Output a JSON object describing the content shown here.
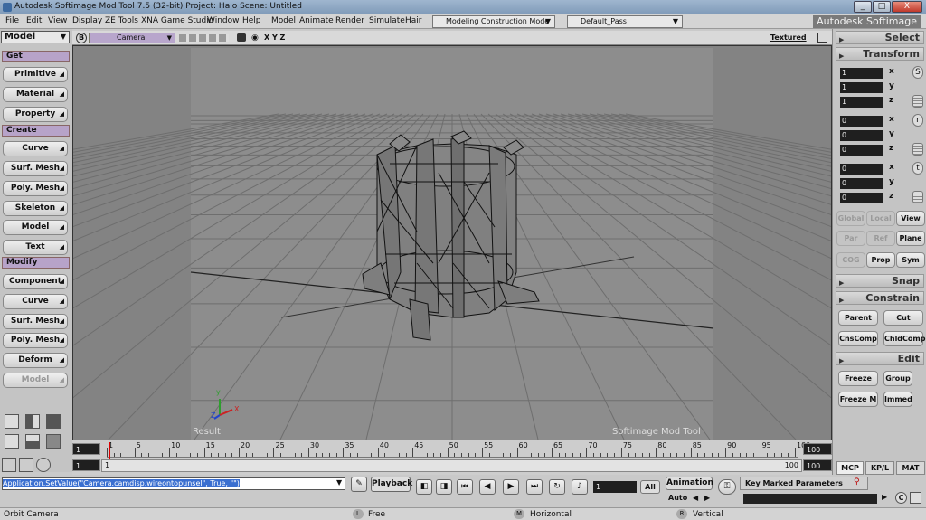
{
  "window": {
    "title": "Autodesk Softimage Mod Tool 7.5 (32-bit)     Project: Halo     Scene: Untitled",
    "min_label": "_",
    "max_label": "□",
    "close_label": "X"
  },
  "menu": {
    "items": [
      "File",
      "Edit",
      "View",
      "Display",
      "ZE Tools",
      "XNA Game Studio",
      "Window",
      "Help",
      "Model",
      "Animate",
      "Render",
      "Simulate",
      "Hair"
    ],
    "mode_dropdown": "Modeling Construction Mode",
    "pass_dropdown": "Default_Pass",
    "brand": "Autodesk Softimage"
  },
  "left_panel": {
    "mode_select": "Model",
    "get_header": "Get",
    "get_buttons": [
      "Primitive",
      "Material",
      "Property"
    ],
    "create_header": "Create",
    "create_buttons": [
      "Curve",
      "Surf. Mesh",
      "Poly. Mesh",
      "Skeleton",
      "Model",
      "Text"
    ],
    "modify_header": "Modify",
    "modify_buttons": [
      "Component",
      "Curve",
      "Surf. Mesh",
      "Poly. Mesh",
      "Deform",
      "Model"
    ]
  },
  "viewport": {
    "b_label": "B",
    "camera_select": "Camera",
    "xyz": "X Y Z",
    "display_mode": "Textured",
    "result_label": "Result",
    "watermark": "Softimage Mod Tool",
    "axes": {
      "y": "y",
      "x": "X",
      "z": "Z"
    }
  },
  "timeline": {
    "start_frame": "1",
    "end_frame": "100",
    "current_start": "1",
    "range_end_a": "100",
    "range_end_b": "100",
    "slider_start": "1",
    "ticks": [
      "1",
      "5",
      "10",
      "15",
      "20",
      "25",
      "30",
      "35",
      "40",
      "45",
      "50",
      "55",
      "60",
      "65",
      "70",
      "75",
      "80",
      "85",
      "90",
      "95",
      "100"
    ],
    "current_frame_fraction": 0.0
  },
  "command_bar": {
    "command_text": "Application.SetValue(\"Camera.camdisp.wireontopunsel\", True, \"\")",
    "playback_label": "Playback",
    "frame_value": "1",
    "all_label": "All",
    "animation_label": "Animation",
    "auto_label": "Auto",
    "key_marked_label": "Key Marked Parameters"
  },
  "status_bar": {
    "camera_label": "Orbit Camera",
    "l_label": "L",
    "l_text": "Free",
    "m_label": "M",
    "m_text": "Horizontal",
    "r_label": "R",
    "r_text": "Vertical"
  },
  "right_panel": {
    "select_header": "Select",
    "transform_header": "Transform",
    "scale_values": [
      "1",
      "1",
      "1"
    ],
    "rotate_values": [
      "0",
      "0",
      "0"
    ],
    "translate_values": [
      "0",
      "0",
      "0"
    ],
    "axis_labels": [
      "x",
      "y",
      "z"
    ],
    "s_label": "S",
    "r_label": "r",
    "t_label": "t",
    "space_buttons": [
      "Global",
      "Local",
      "View"
    ],
    "ref_buttons": [
      "Par",
      "Ref",
      "Plane"
    ],
    "misc_buttons": [
      "COG",
      "Prop",
      "Sym"
    ],
    "snap_header": "Snap",
    "constrain_header": "Constrain",
    "constrain_buttons": [
      "Parent",
      "Cut",
      "CnsComp",
      "ChldComp"
    ],
    "edit_header": "Edit",
    "edit_buttons": [
      "Freeze",
      "Group",
      "Freeze M",
      "Immed"
    ],
    "tabs": [
      "MCP",
      "KP/L",
      "MAT"
    ]
  }
}
